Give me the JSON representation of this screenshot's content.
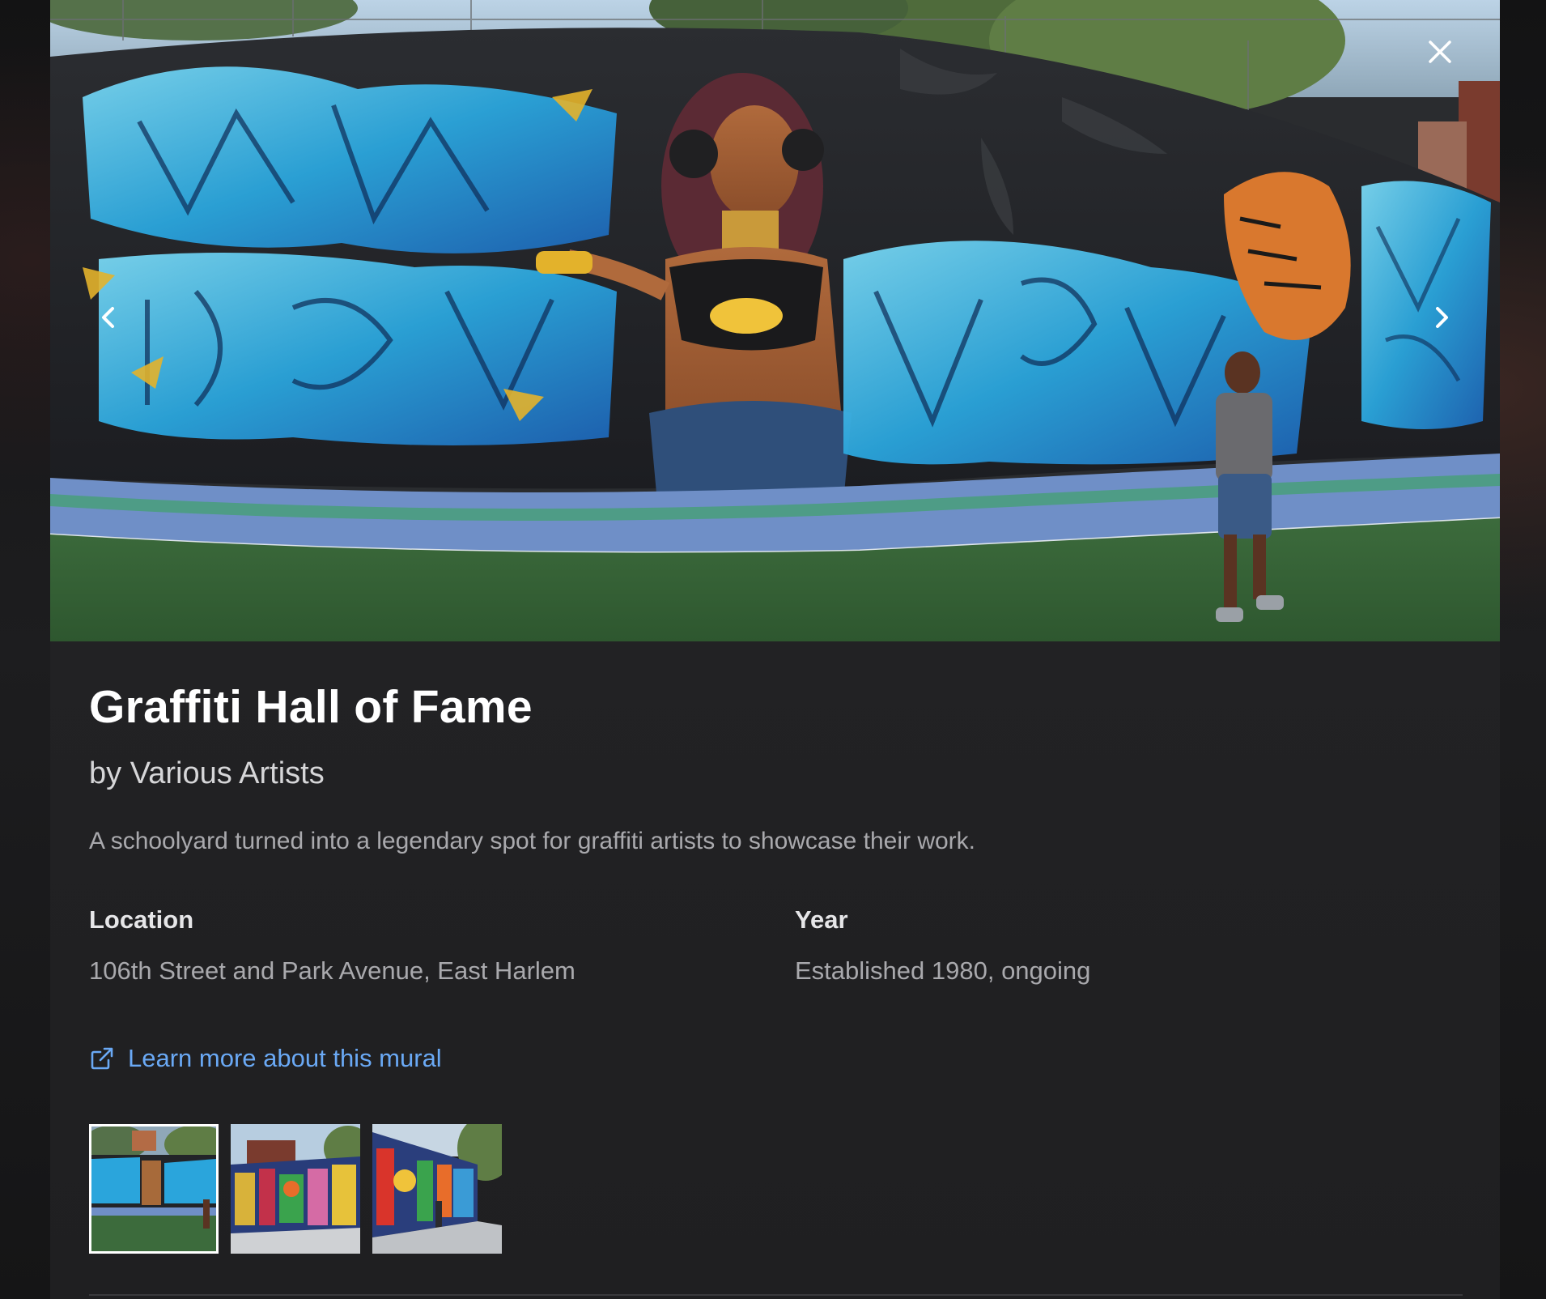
{
  "mural": {
    "title": "Graffiti Hall of Fame",
    "byline": "by Various Artists",
    "description": "A schoolyard turned into a legendary spot for graffiti artists to showcase their work.",
    "location_label": "Location",
    "location_value": "106th Street and Park Avenue, East Harlem",
    "year_label": "Year",
    "year_value": "Established 1980, ongoing",
    "link_label": "Learn more about this mural"
  },
  "gallery": {
    "thumbnails": [
      {
        "name": "thumbnail-1",
        "active": true
      },
      {
        "name": "thumbnail-2",
        "active": false
      },
      {
        "name": "thumbnail-3",
        "active": false
      }
    ]
  },
  "icons": {
    "close": "close-icon",
    "prev": "chevron-left-icon",
    "next": "chevron-right-icon",
    "link": "external-link-icon"
  },
  "colors": {
    "link": "#6aa9f5",
    "title": "#ffffff",
    "muted_text": "#a9a9ad",
    "modal_background": "#1f1f21"
  }
}
